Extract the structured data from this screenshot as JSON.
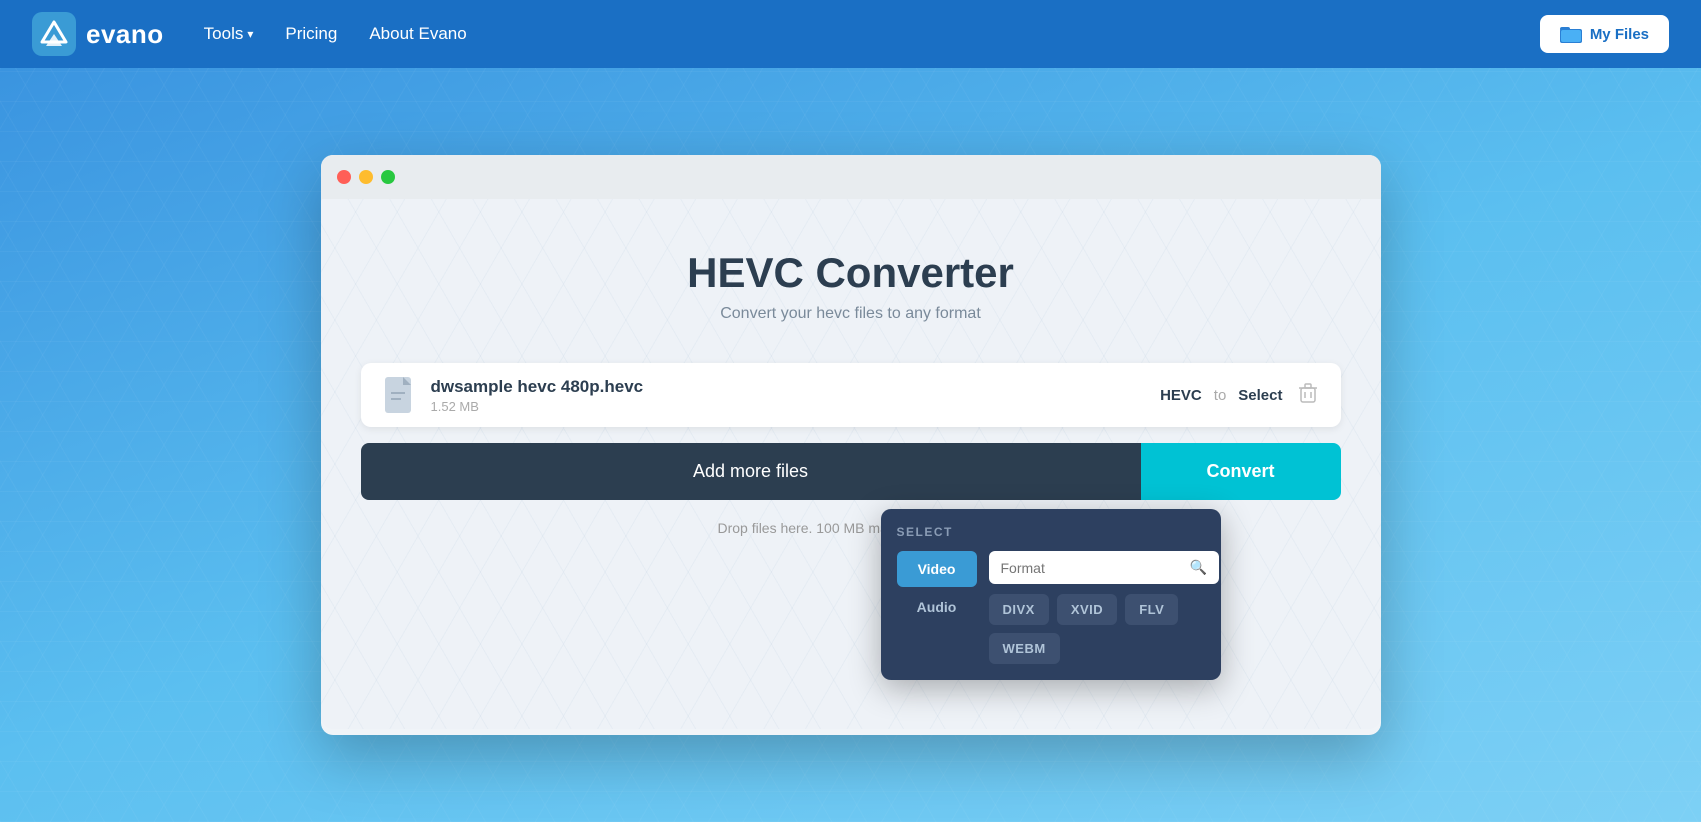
{
  "nav": {
    "logo_text": "evano",
    "tools_label": "Tools",
    "pricing_label": "Pricing",
    "about_label": "About Evano",
    "my_files_label": "My Files"
  },
  "page": {
    "title": "HEVC Converter",
    "subtitle": "Convert your hevc files to any format"
  },
  "file": {
    "name": "dwsample hevc 480p.hevc",
    "size": "1.52 MB",
    "format_from": "HEVC",
    "format_to_separator": "to",
    "format_select_label": "Select"
  },
  "actions": {
    "add_files_label": "Add more files",
    "convert_label": "Convert"
  },
  "drop_text": "Drop files here. 100 MB maximum file size.",
  "select_dropdown": {
    "header": "SELECT",
    "search_placeholder": "Format",
    "tabs": [
      {
        "label": "Video",
        "active": true
      },
      {
        "label": "Audio",
        "active": false
      }
    ],
    "formats": [
      "DIVX",
      "XVID",
      "FLV",
      "WEBM"
    ]
  },
  "window_controls": {
    "dot1": "red",
    "dot2": "yellow",
    "dot3": "green"
  }
}
